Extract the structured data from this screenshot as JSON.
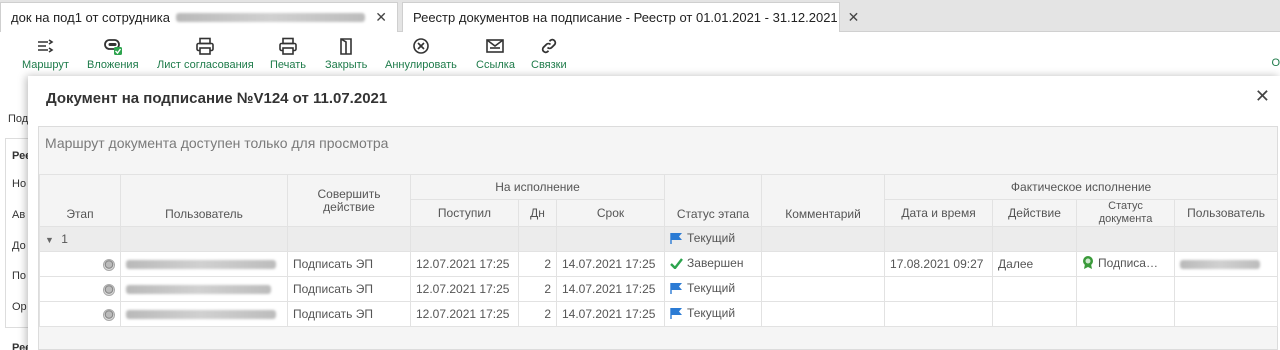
{
  "tabs": [
    {
      "label": "док на под1 от сотрудника",
      "close": "✕"
    },
    {
      "label": "Реестр документов на подписание - Реестр от 01.01.2021 - 31.12.2021",
      "close": "✕"
    }
  ],
  "toolbar": {
    "items": [
      {
        "label": "Маршрут",
        "icon": "route-icon"
      },
      {
        "label": "Вложения",
        "icon": "attachments-icon"
      },
      {
        "label": "Лист согласования",
        "icon": "print-icon"
      },
      {
        "label": "Печать",
        "icon": "print-icon"
      },
      {
        "label": "Закрыть",
        "icon": "close-doc-icon"
      },
      {
        "label": "Аннулировать",
        "icon": "cancel-circle-icon"
      },
      {
        "label": "Ссылка",
        "icon": "mail-icon"
      },
      {
        "label": "Связки",
        "icon": "link-icon"
      }
    ],
    "right_label": "О"
  },
  "background": {
    "labels": [
      "Под",
      "Рее",
      "Но",
      "Ав",
      "До",
      "По",
      "Ор",
      "Рее"
    ]
  },
  "modal": {
    "title": "Документ на подписание №V124 от 11.07.2021",
    "close": "✕",
    "notice": "Маршрут документа доступен только для просмотра",
    "headers": {
      "stage": "Этап",
      "user": "Пользователь",
      "action": "Совершить действие",
      "on_exec": "На исполнение",
      "received": "Поступил",
      "days": "Дн",
      "deadline": "Срок",
      "stage_status": "Статус этапа",
      "comment": "Комментарий",
      "actual": "Фактическое исполнение",
      "datetime": "Дата и время",
      "act": "Действие",
      "doc_status": "Статус документа",
      "act_user": "Пользователь"
    },
    "group": {
      "label": "1",
      "status": "Текущий"
    },
    "rows": [
      {
        "action": "Подписать ЭП",
        "received": "12.07.2021 17:25",
        "days": "2",
        "deadline": "14.07.2021 17:25",
        "status": "Завершен",
        "status_icon": "check-icon",
        "comment": "",
        "datetime": "17.08.2021 09:27",
        "act": "Далее",
        "doc_status": "Подписа…",
        "has_user": true
      },
      {
        "action": "Подписать ЭП",
        "received": "12.07.2021 17:25",
        "days": "2",
        "deadline": "14.07.2021 17:25",
        "status": "Текущий",
        "status_icon": "flag-icon",
        "comment": "",
        "datetime": "",
        "act": "",
        "doc_status": "",
        "has_user": false
      },
      {
        "action": "Подписать ЭП",
        "received": "12.07.2021 17:25",
        "days": "2",
        "deadline": "14.07.2021 17:25",
        "status": "Текущий",
        "status_icon": "flag-icon",
        "comment": "",
        "datetime": "",
        "act": "",
        "doc_status": "",
        "has_user": false
      }
    ]
  },
  "colors": {
    "accent": "#1e7b4a",
    "flag": "#2b7bd4",
    "check": "#2da44e",
    "badge": "#3a9a3a"
  }
}
